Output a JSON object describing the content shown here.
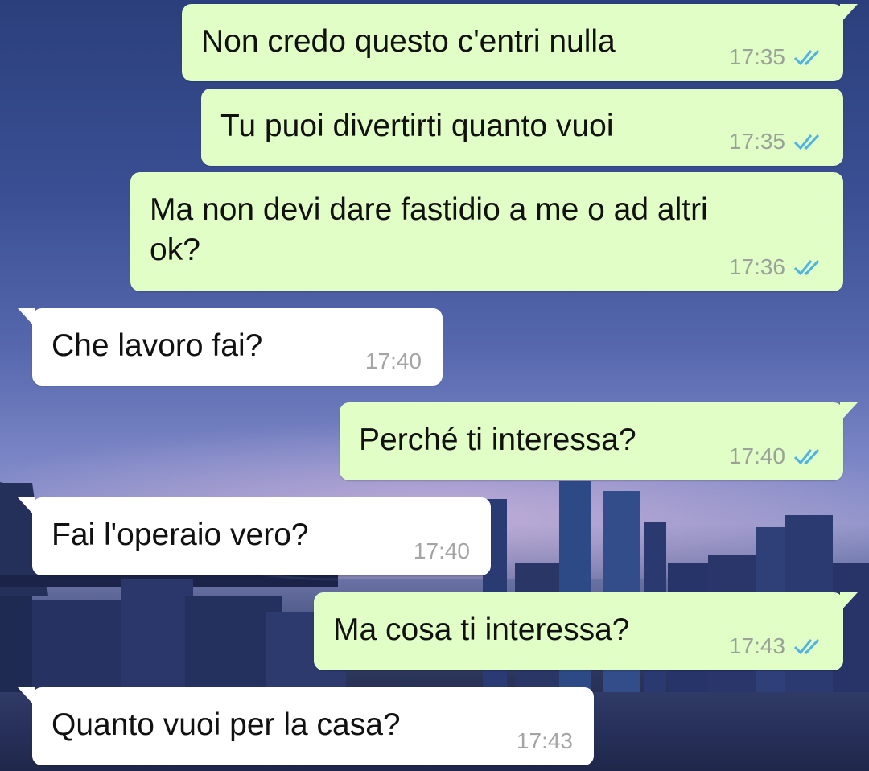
{
  "colors": {
    "outgoing_bubble": "#e1fec6",
    "incoming_bubble": "#ffffff",
    "read_ticks": "#4fb3e6",
    "timestamp": "#9aa29a"
  },
  "messages": [
    {
      "direction": "out",
      "text": "Non credo questo c'entri nulla",
      "time": "17:35",
      "status": "read-ticks-icon"
    },
    {
      "direction": "out",
      "text": "Tu puoi divertirti quanto vuoi",
      "time": "17:35",
      "status": "read-ticks-icon"
    },
    {
      "direction": "out",
      "text": "Ma non devi dare fastidio a me o ad altri\nok?",
      "time": "17:36",
      "status": "read-ticks-icon"
    },
    {
      "direction": "in",
      "text": "Che lavoro fai?",
      "time": "17:40"
    },
    {
      "direction": "out",
      "text": "Perché ti interessa?",
      "time": "17:40",
      "status": "read-ticks-icon"
    },
    {
      "direction": "in",
      "text": "Fai l'operaio vero?",
      "time": "17:40"
    },
    {
      "direction": "out",
      "text": "Ma cosa ti interessa?",
      "time": "17:43",
      "status": "read-ticks-icon"
    },
    {
      "direction": "in",
      "text": "Quanto vuoi per la casa?",
      "time": "17:43"
    }
  ]
}
